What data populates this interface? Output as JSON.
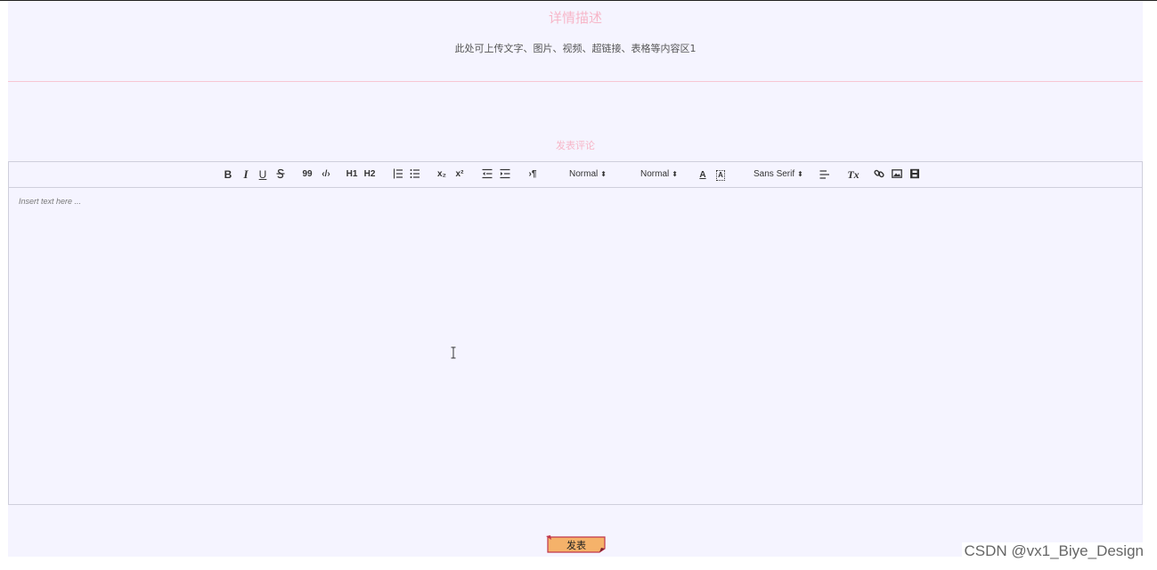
{
  "detail": {
    "title": "详情描述",
    "content": "此处可上传文字、图片、视频、超链接、表格等内容区1"
  },
  "comment": {
    "title": "发表评论",
    "editor": {
      "toolbar": {
        "bold": "B",
        "italic": "I",
        "underline": "U",
        "strike": "S",
        "blockquote": "99",
        "code": "‹/›",
        "h1": "H1",
        "h2": "H2",
        "ordered_list": "ordered-list-icon",
        "bullet_list": "bullet-list-icon",
        "subscript": "x₂",
        "superscript": "x²",
        "outdent": "outdent-icon",
        "indent": "indent-icon",
        "direction": "›¶",
        "size_select": "Normal",
        "header_select": "Normal",
        "text_color": "A",
        "background_color": "A",
        "font_select": "Sans Serif",
        "align": "align-icon",
        "clean": "Tx",
        "link": "link-icon",
        "image": "image-icon",
        "video": "video-icon"
      },
      "placeholder": "Insert text here ..."
    },
    "submit_label": "发表"
  },
  "watermark": "CSDN @vx1_Biye_Design",
  "colors": {
    "accent_pink": "#f7b6c8",
    "page_bg": "#f5f4ff",
    "button_fill": "#f5b26a",
    "button_border": "#c0364b"
  }
}
